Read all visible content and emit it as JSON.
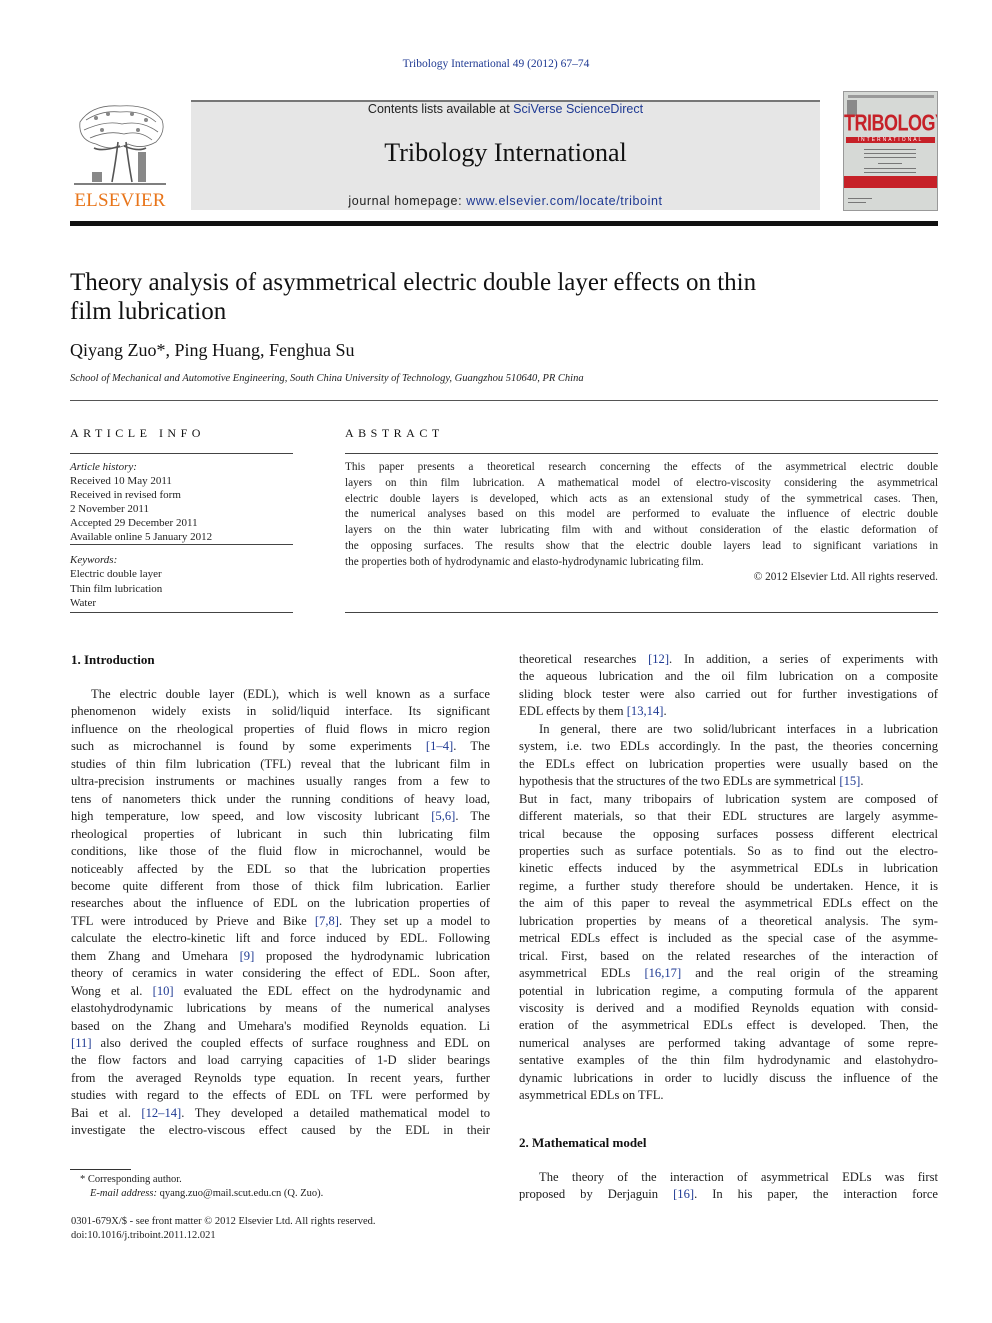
{
  "header": {
    "citation": "Tribology International 49 (2012) 67–74",
    "contents_prefix": "Contents lists available at ",
    "contents_link": "SciVerse ScienceDirect",
    "journal_name": "Tribology International",
    "homepage_prefix": "journal homepage: ",
    "homepage_link": "www.elsevier.com/locate/triboint",
    "publisher_logo_text": "ELSEVIER",
    "cover": {
      "title": "TRIBOLOGY",
      "band": "INTERNATIONAL",
      "accent_color": "#c62128"
    },
    "publisher_color": "#e8751a",
    "link_color": "#1f3a93"
  },
  "article": {
    "title_lines": [
      "Theory analysis of asymmetrical electric double layer effects on thin",
      "film lubrication"
    ],
    "authors": "Qiyang Zuo*, Ping Huang, Fenghua Su",
    "affiliation": "School of Mechanical and Automotive Engineering, South China University of Technology, Guangzhou 510640, PR China"
  },
  "article_info": {
    "heading": "ARTICLE INFO",
    "history_label": "Article history:",
    "history": [
      "Received 10 May 2011",
      "Received in revised form",
      "2 November 2011",
      "Accepted 29 December 2011",
      "Available online 5 January 2012"
    ],
    "keywords_label": "Keywords:",
    "keywords": [
      "Electric double layer",
      "Thin film lubrication",
      "Water"
    ]
  },
  "abstract": {
    "heading": "ABSTRACT",
    "lines": [
      "This paper presents a theoretical research concerning the effects of the asymmetrical electric double",
      "layers on thin film lubrication. A mathematical model of electro-viscosity considering the asymmetrical",
      "electric double layers is developed, which acts as an extensional study of the symmetrical cases. Then,",
      "the numerical analyses based on this model are performed to evaluate the influence of electric double",
      "layers on the thin water lubricating film with and without consideration of the elastic deformation of",
      "the opposing surfaces. The results show that the electric double layers lead to significant variations in",
      "the properties both of hydrodynamic and elasto-hydrodynamic lubricating film."
    ],
    "copyright": "© 2012 Elsevier Ltd. All rights reserved."
  },
  "sections": {
    "intro_heading": "1.   Introduction",
    "model_heading": "2.   Mathematical model"
  },
  "left_column": [
    [
      {
        "t": "The electric double layer (EDL), which is well known as a surface"
      }
    ],
    [
      {
        "t": "phenomenon widely exists in solid/liquid interface. Its significant"
      }
    ],
    [
      {
        "t": "influence on the rheological properties of fluid flows in micro region"
      }
    ],
    [
      {
        "t": "such as microchannel is found by some experiments "
      },
      {
        "c": "[1–4]"
      },
      {
        "t": ". The"
      }
    ],
    [
      {
        "t": "studies of thin film lubrication (TFL) reveal that the lubricant film in"
      }
    ],
    [
      {
        "t": "ultra-precision instruments or machines usually ranges from a few to"
      }
    ],
    [
      {
        "t": "tens of nanometers thick under the running conditions of heavy load,"
      }
    ],
    [
      {
        "t": "high temperature, low speed, and low viscosity lubricant "
      },
      {
        "c": "[5,6]"
      },
      {
        "t": ". The"
      }
    ],
    [
      {
        "t": "rheological properties of lubricant in such thin lubricating film"
      }
    ],
    [
      {
        "t": "conditions, like those of the fluid flow in microchannel, would be"
      }
    ],
    [
      {
        "t": "noticeably affected by the EDL so that the lubrication properties"
      }
    ],
    [
      {
        "t": "become quite different from those of thick film lubrication. Earlier"
      }
    ],
    [
      {
        "t": "researches about the influence of EDL on the lubrication properties of"
      }
    ],
    [
      {
        "t": "TFL were introduced by Prieve and Bike "
      },
      {
        "c": "[7,8]"
      },
      {
        "t": ". They set up a model to"
      }
    ],
    [
      {
        "t": "calculate the electro-kinetic lift and force induced by EDL. Following"
      }
    ],
    [
      {
        "t": "them Zhang and Umehara "
      },
      {
        "c": "[9]"
      },
      {
        "t": " proposed the hydrodynamic lubrication"
      }
    ],
    [
      {
        "t": "theory of ceramics in water considering the effect of EDL. Soon after,"
      }
    ],
    [
      {
        "t": "Wong et al. "
      },
      {
        "c": "[10]"
      },
      {
        "t": " evaluated the EDL effect on the hydrodynamic and"
      }
    ],
    [
      {
        "t": "elastohydrodynamic lubrications by means of the numerical analyses"
      }
    ],
    [
      {
        "t": "based on the Zhang and Umehara's modified Reynolds equation. Li"
      }
    ],
    [
      {
        "c": "[11]"
      },
      {
        "t": " also derived the coupled effects of surface roughness and EDL on"
      }
    ],
    [
      {
        "t": "the flow factors and load carrying capacities of 1-D slider bearings"
      }
    ],
    [
      {
        "t": "from the averaged Reynolds type equation. In recent years, further"
      }
    ],
    [
      {
        "t": "studies with regard to the effects of EDL on TFL were performed by"
      }
    ],
    [
      {
        "t": "Bai et al. "
      },
      {
        "c": "[12–14]"
      },
      {
        "t": ". They developed a detailed mathematical model to"
      }
    ],
    [
      {
        "t": "investigate the electro-viscous effect caused by the EDL in their"
      }
    ]
  ],
  "right_column": [
    [
      {
        "t": "theoretical researches "
      },
      {
        "c": "[12]"
      },
      {
        "t": ". In addition, a series of experiments with"
      }
    ],
    [
      {
        "t": "the aqueous lubrication and the oil film lubrication on a composite"
      }
    ],
    [
      {
        "t": "sliding block tester were also carried out for further investigations of"
      }
    ],
    [
      {
        "t": "EDL effects by them "
      },
      {
        "c": "[13,14]"
      },
      {
        "t": "."
      }
    ],
    [
      {
        "t": "In general, there are two solid/lubricant interfaces in a lubrication"
      }
    ],
    [
      {
        "t": "system, i.e. two EDLs accordingly. In the past, the theories concerning"
      }
    ],
    [
      {
        "t": "the EDLs effect on lubrication properties were usually based on the"
      }
    ],
    [
      {
        "t": "hypothesis that the structures of the two EDLs are symmetrical "
      },
      {
        "c": "[15]"
      },
      {
        "t": "."
      }
    ],
    [
      {
        "t": "But in fact, many tribopairs of lubrication system are composed of"
      }
    ],
    [
      {
        "t": "different materials, so that their EDL structures are largely asymme-"
      }
    ],
    [
      {
        "t": "trical because the opposing surfaces possess different electrical"
      }
    ],
    [
      {
        "t": "properties such as surface potentials. So as to find out the electro-"
      }
    ],
    [
      {
        "t": "kinetic effects induced by the asymmetrical EDLs in lubrication"
      }
    ],
    [
      {
        "t": "regime, a further study therefore should be undertaken. Hence, it is"
      }
    ],
    [
      {
        "t": "the aim of this paper to reveal the asymmetrical EDLs effect on the"
      }
    ],
    [
      {
        "t": "lubrication properties by means of a theoretical analysis. The sym-"
      }
    ],
    [
      {
        "t": "metrical EDLs effect is included as the special case of the asymme-"
      }
    ],
    [
      {
        "t": "trical. First, based on the related researches of the interaction of"
      }
    ],
    [
      {
        "t": "asymmetrical EDLs "
      },
      {
        "c": "[16,17]"
      },
      {
        "t": " and the real origin of the streaming"
      }
    ],
    [
      {
        "t": "potential in lubrication regime, a computing formula of the apparent"
      }
    ],
    [
      {
        "t": "viscosity is derived and a modified Reynolds equation with consid-"
      }
    ],
    [
      {
        "t": "eration of the asymmetrical EDLs effect is developed. Then, the"
      }
    ],
    [
      {
        "t": "numerical analyses are performed taking advantage of some repre-"
      }
    ],
    [
      {
        "t": "sentative examples of the thin film hydrodynamic and elastohydro-"
      }
    ],
    [
      {
        "t": "dynamic lubrications in order to lucidly discuss the influence of the"
      }
    ],
    [
      {
        "t": "asymmetrical EDLs on TFL."
      }
    ]
  ],
  "model_lines": [
    [
      {
        "t": "The theory of the interaction of asymmetrical EDLs was first"
      }
    ],
    [
      {
        "t": "proposed by Derjaguin "
      },
      {
        "c": "[16]"
      },
      {
        "t": ". In his paper, the interaction force"
      }
    ]
  ],
  "footnotes": {
    "corresponding": "* Corresponding author.",
    "email_label": "E-mail address:",
    "email": " qyang.zuo@mail.scut.edu.cn (Q. Zuo).",
    "issn": "0301-679X/$ - see front matter © 2012 Elsevier Ltd. All rights reserved.",
    "doi": "doi:10.1016/j.triboint.2011.12.021"
  }
}
